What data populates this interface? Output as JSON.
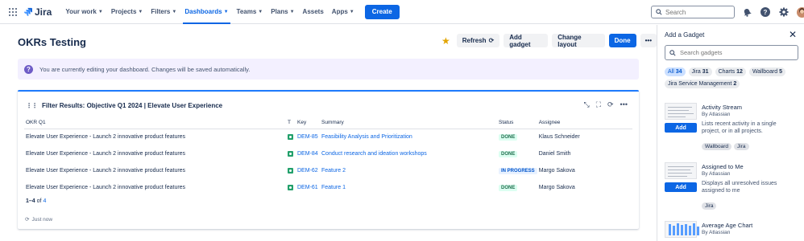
{
  "topbar": {
    "app_name": "Jira",
    "nav": [
      {
        "label": "Your work",
        "active": false
      },
      {
        "label": "Projects",
        "active": false
      },
      {
        "label": "Filters",
        "active": false
      },
      {
        "label": "Dashboards",
        "active": true
      },
      {
        "label": "Teams",
        "active": false
      },
      {
        "label": "Plans",
        "active": false
      },
      {
        "label": "Assets",
        "active": false
      },
      {
        "label": "Apps",
        "active": false
      }
    ],
    "create_label": "Create",
    "search_placeholder": "Search",
    "icons": [
      "notification-bell-icon",
      "help-icon",
      "settings-gear-icon",
      "user-avatar"
    ]
  },
  "dashboard": {
    "title": "OKRs Testing",
    "actions": {
      "refresh": "Refresh",
      "add_gadget": "Add gadget",
      "change_layout": "Change layout",
      "done": "Done"
    },
    "banner_text": "You are currently editing your dashboard. Changes will be saved automatically."
  },
  "gadget": {
    "title": "Filter Results: Objective Q1 2024 | Elevate User Experience",
    "columns": [
      "OKR Q1",
      "T",
      "Key",
      "Summary",
      "Status",
      "Assignee"
    ],
    "rows": [
      {
        "okr": "Elevate User Experience - Launch 2 innovative product features",
        "key": "DEM-85",
        "summary": "Feasibility Analysis and Prioritization",
        "status": "DONE",
        "assignee": "Klaus Schneider"
      },
      {
        "okr": "Elevate User Experience - Launch 2 innovative product features",
        "key": "DEM-84",
        "summary": "Conduct research and ideation workshops",
        "status": "DONE",
        "assignee": "Daniel Smith"
      },
      {
        "okr": "Elevate User Experience - Launch 2 innovative product features",
        "key": "DEM-62",
        "summary": "Feature 2",
        "status": "IN PROGRESS",
        "assignee": "Margo Sakova"
      },
      {
        "okr": "Elevate User Experience - Launch 2 innovative product features",
        "key": "DEM-61",
        "summary": "Feature 1",
        "status": "DONE",
        "assignee": "Margo Sakova"
      }
    ],
    "pager_range": "1–4",
    "pager_of": "of",
    "pager_total": "4",
    "updated": "Just now"
  },
  "side_panel": {
    "title": "Add a Gadget",
    "search_placeholder": "Search gadgets",
    "chips": [
      {
        "label": "All",
        "count": "34",
        "selected": true
      },
      {
        "label": "Jira",
        "count": "31",
        "selected": false
      },
      {
        "label": "Charts",
        "count": "12",
        "selected": false
      },
      {
        "label": "Wallboard",
        "count": "5",
        "selected": false
      },
      {
        "label": "Jira Service Management",
        "count": "2",
        "selected": false
      }
    ],
    "add_label": "Add",
    "gadgets": [
      {
        "name": "Activity Stream",
        "by": "By Atlassian",
        "desc": "Lists recent activity in a single project, or in all projects.",
        "tags": [
          "Wallboard",
          "Jira"
        ]
      },
      {
        "name": "Assigned to Me",
        "by": "By Atlassian",
        "desc": "Displays all unresolved issues assigned to me",
        "tags": [
          "Jira"
        ]
      },
      {
        "name": "Average Age Chart",
        "by": "By Atlassian",
        "desc": "",
        "tags": []
      }
    ]
  }
}
